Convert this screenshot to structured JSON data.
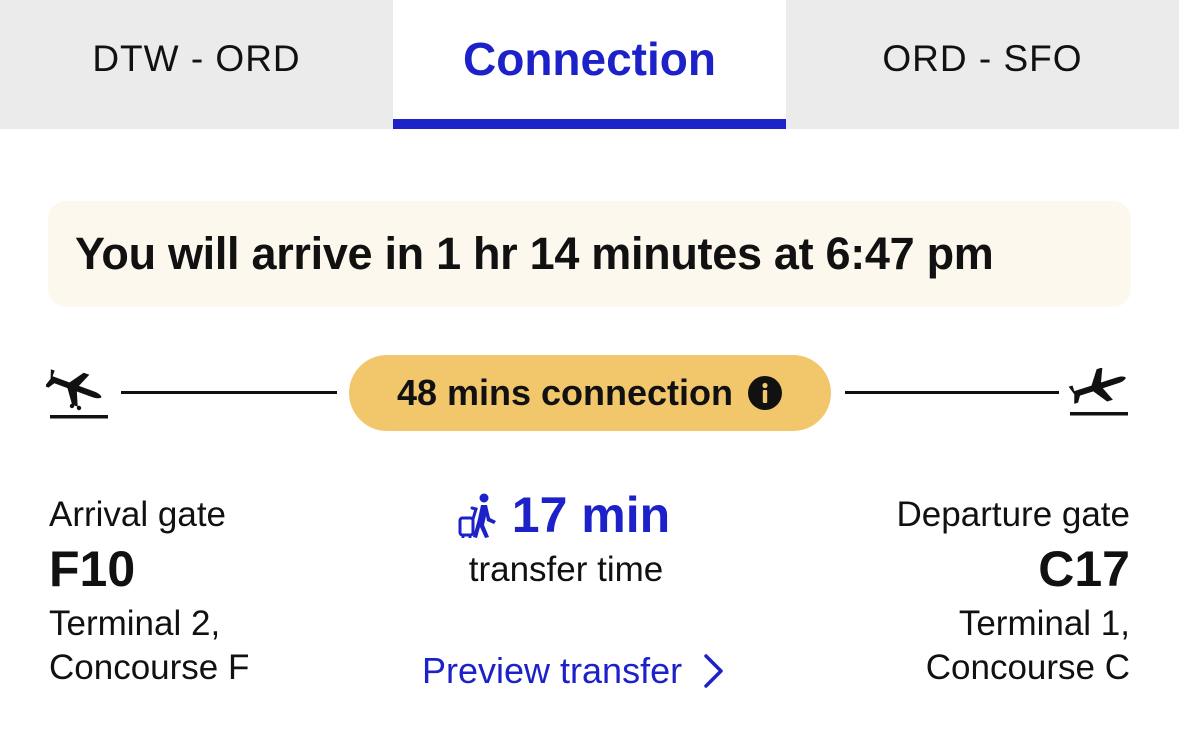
{
  "tabs": [
    {
      "label": "DTW - ORD",
      "active": false
    },
    {
      "label": "Connection",
      "active": true
    },
    {
      "label": "ORD - SFO",
      "active": false
    }
  ],
  "banner": {
    "text": "You will arrive in 1 hr 14 minutes at 6:47 pm"
  },
  "connection": {
    "label": "48 mins connection",
    "arrival_icon": "plane-landing-icon",
    "departure_icon": "plane-takeoff-icon",
    "info_icon": "info-icon"
  },
  "arrival": {
    "label": "Arrival gate",
    "gate": "F10",
    "terminal_line1": "Terminal 2,",
    "terminal_line2": "Concourse F"
  },
  "transfer": {
    "icon": "walking-with-luggage-icon",
    "minutes": "17 min",
    "subtitle": "transfer time",
    "preview_label": "Preview transfer"
  },
  "departure": {
    "label": "Departure gate",
    "gate": "C17",
    "terminal_line1": "Terminal 1,",
    "terminal_line2": "Concourse C"
  },
  "colors": {
    "accent": "#1c22c8",
    "tab_inactive_bg": "#ebebeb",
    "banner_bg": "#fcf8ee",
    "pill_bg": "#f2c76c",
    "text": "#111111"
  }
}
